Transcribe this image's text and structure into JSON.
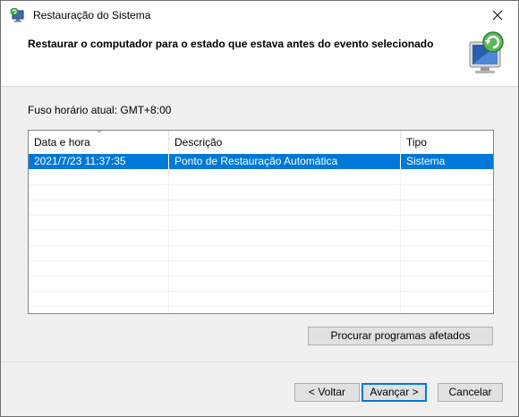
{
  "window": {
    "title": "Restauração do Sistema",
    "close_glyph": "✕"
  },
  "header": {
    "title": "Restaurar o computador para o estado que estava antes do evento selecionado",
    "icon": "system-restore-icon"
  },
  "timezone_label": "Fuso horário atual: GMT+8:00",
  "table": {
    "columns": [
      "Data e hora",
      "Descrição",
      "Tipo"
    ],
    "sorted_column": "Data e hora",
    "rows": [
      {
        "date": "2021/7/23 11:37:35",
        "description": "Ponto de Restauração Automática",
        "type": "Sistema",
        "selected": true
      }
    ]
  },
  "buttons": {
    "scan": "Procurar programas afetados",
    "back": "< Voltar",
    "next": "Avançar >",
    "cancel": "Cancelar"
  },
  "colors": {
    "selection": "#0078d7",
    "dialog_bg": "#f0f0f0"
  }
}
